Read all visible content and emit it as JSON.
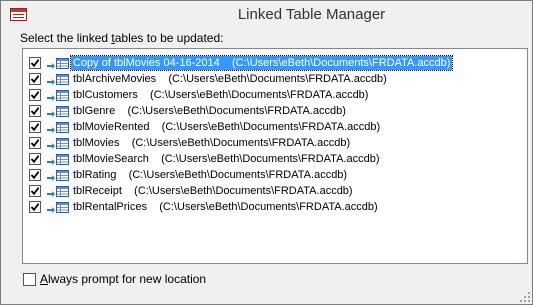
{
  "window": {
    "title": "Linked Table Manager",
    "icon": "access-app-icon"
  },
  "instruction": {
    "pre": "Select the linked ",
    "accel": "t",
    "post": "ables to be updated:"
  },
  "tables": [
    {
      "name": "Copy of tblMovies 04-16-2014",
      "path": "(C:\\Users\\eBeth\\Documents\\FRDATA.accdb)",
      "checked": true,
      "selected": true
    },
    {
      "name": "tblArchiveMovies",
      "path": "(C:\\Users\\eBeth\\Documents\\FRDATA.accdb)",
      "checked": true,
      "selected": false
    },
    {
      "name": "tblCustomers",
      "path": "(C:\\Users\\eBeth\\Documents\\FRDATA.accdb)",
      "checked": true,
      "selected": false
    },
    {
      "name": "tblGenre",
      "path": "(C:\\Users\\eBeth\\Documents\\FRDATA.accdb)",
      "checked": true,
      "selected": false
    },
    {
      "name": "tblMovieRented",
      "path": "(C:\\Users\\eBeth\\Documents\\FRDATA.accdb)",
      "checked": true,
      "selected": false
    },
    {
      "name": "tblMovies",
      "path": "(C:\\Users\\eBeth\\Documents\\FRDATA.accdb)",
      "checked": true,
      "selected": false
    },
    {
      "name": "tblMovieSearch",
      "path": "(C:\\Users\\eBeth\\Documents\\FRDATA.accdb)",
      "checked": true,
      "selected": false
    },
    {
      "name": "tblRating",
      "path": "(C:\\Users\\eBeth\\Documents\\FRDATA.accdb)",
      "checked": true,
      "selected": false
    },
    {
      "name": "tblReceipt",
      "path": "(C:\\Users\\eBeth\\Documents\\FRDATA.accdb)",
      "checked": true,
      "selected": false
    },
    {
      "name": "tblRentalPrices",
      "path": "(C:\\Users\\eBeth\\Documents\\FRDATA.accdb)",
      "checked": true,
      "selected": false
    }
  ],
  "always_prompt": {
    "accel": "A",
    "rest": "lways prompt for new location",
    "checked": false
  },
  "colors": {
    "selection": "#3399ff",
    "check": "#000000",
    "link_arrow": "#3a78c2"
  }
}
